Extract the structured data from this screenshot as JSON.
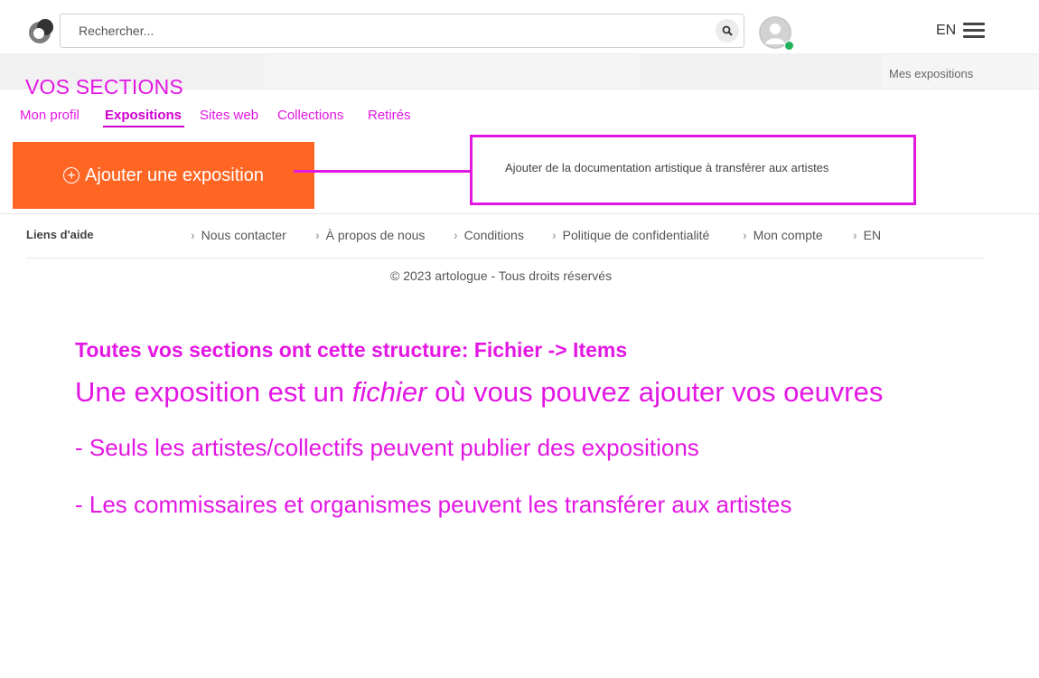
{
  "header": {
    "search_placeholder": "Rechercher...",
    "lang": "EN"
  },
  "strip": {
    "mes_expositions": "Mes expositions"
  },
  "sections": {
    "title": "VOS SECTIONS",
    "tabs": [
      {
        "label": "Mon profil",
        "active": false
      },
      {
        "label": "Expositions",
        "active": true
      },
      {
        "label": "Sites web",
        "active": false
      },
      {
        "label": "Collections",
        "active": false
      },
      {
        "label": "Retirés",
        "active": false
      }
    ]
  },
  "actions": {
    "add_exposition": "Ajouter une exposition",
    "annotation": "Ajouter de la documentation artistique à transférer aux artistes"
  },
  "footer": {
    "help_label": "Liens d'aide",
    "links": [
      "Nous contacter",
      "À propos de nous",
      "Conditions",
      "Politique de confidentialité",
      "Mon compte",
      "EN"
    ],
    "copyright": "© 2023 artologue - Tous droits réservés"
  },
  "explanation": {
    "heading": "Toutes vos sections ont cette structure: Fichier -> Items",
    "line_prefix": "Une exposition est un ",
    "line_emphasis": "fichier",
    "line_suffix": " où vous pouvez ajouter vos oeuvres",
    "bullets": [
      "- Seuls les artistes/collectifs peuvent publier des expositions",
      "- Les commissaires et organismes peuvent les transférer aux artistes"
    ]
  },
  "colors": {
    "accent": "#e317e3",
    "button": "#ff6624",
    "online": "#1fb35a"
  }
}
